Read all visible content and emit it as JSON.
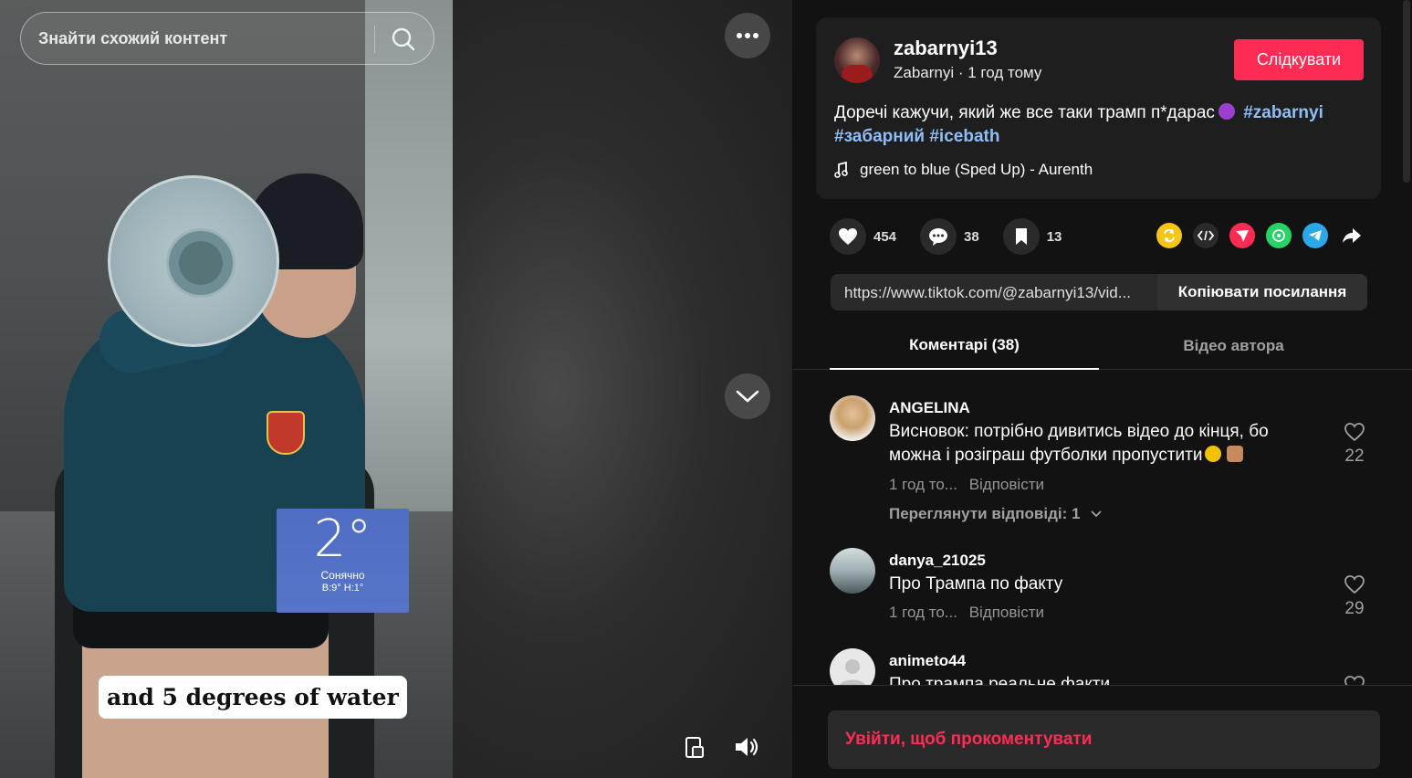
{
  "search": {
    "placeholder": "Знайти схожий контент"
  },
  "video": {
    "weather": {
      "temp": "2°",
      "condition": "Сонячно",
      "range": "В:9°  Н:1°"
    },
    "caption": "and 5 degrees of water"
  },
  "author": {
    "username": "zabarnyi13",
    "subline": "Zabarnyi · 1 год тому",
    "follow_label": "Слідкувати"
  },
  "description": {
    "text": "Доречі кажучи, який же все таки трамп п*дарас",
    "tag1": "#zabarnyi",
    "tag2": "#забарний",
    "tag3": "#icebath"
  },
  "music": {
    "label": "green to blue (Sped Up) - Aurenth"
  },
  "actions": {
    "likes": "454",
    "comments": "38",
    "saves": "13"
  },
  "link": {
    "url": "https://www.tiktok.com/@zabarnyi13/vid...",
    "copy_label": "Копіювати посилання"
  },
  "tabs": {
    "comments": "Коментарі (38)",
    "videos": "Відео автора"
  },
  "comments": [
    {
      "user": "ANGELINA",
      "text_a": "Висновок: потрібно дивитись відео до кінця, бо",
      "text_b": "можна і розіграш футболки пропустити",
      "time": "1 год то...",
      "reply": "Відповісти",
      "likes": "22",
      "view_replies": "Переглянути відповіді: 1"
    },
    {
      "user": "danya_21025",
      "text": "Про Трампа по факту",
      "time": "1 год то...",
      "reply": "Відповісти",
      "likes": "29"
    },
    {
      "user": "animeto44",
      "text": "Про трампа реальне факти"
    }
  ],
  "login": {
    "label": "Увійти, щоб прокоментувати"
  },
  "colors": {
    "accent": "#fe2c55",
    "hashtag": "#8fbef7",
    "panel_bg": "#121212",
    "card_bg": "#1e1e1e"
  }
}
